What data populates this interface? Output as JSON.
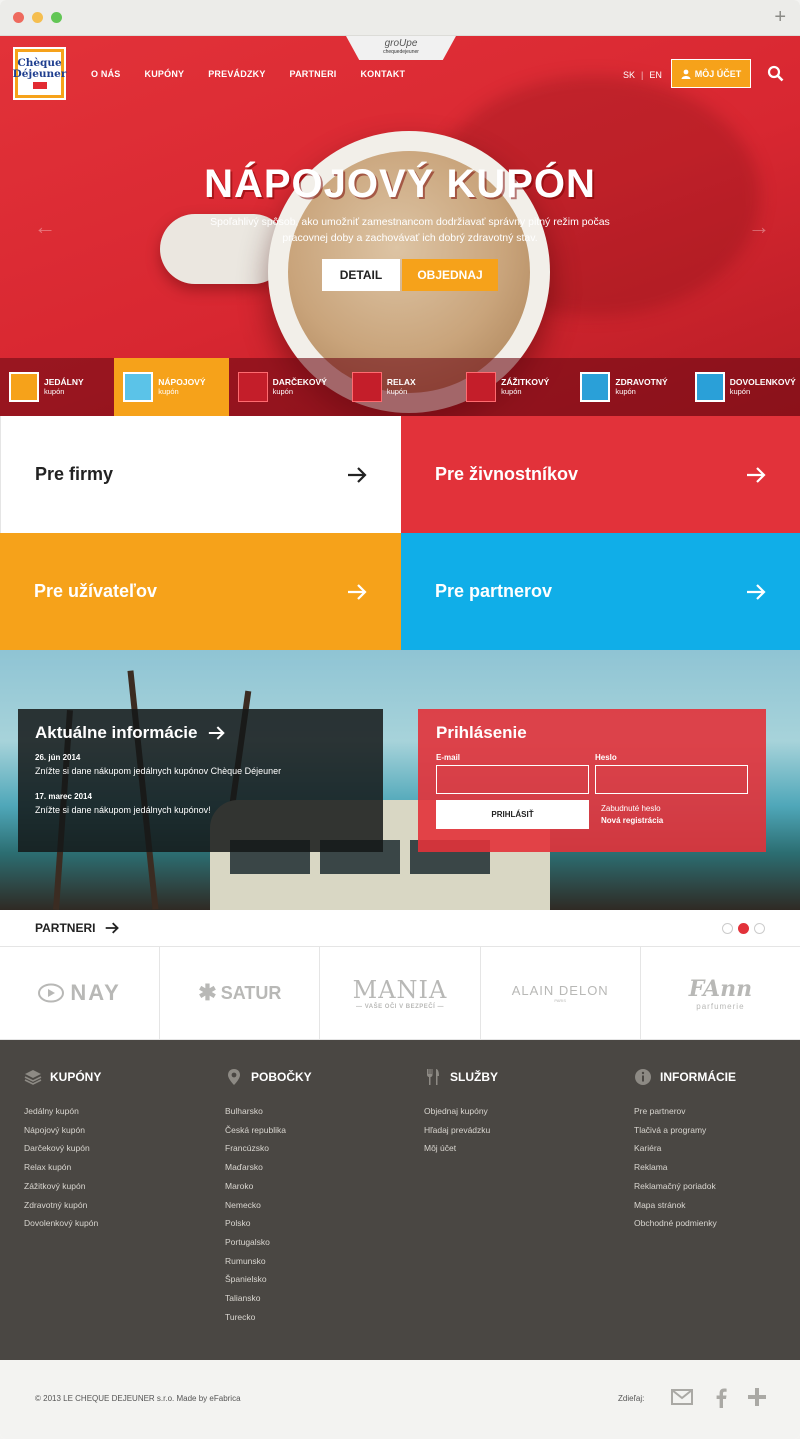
{
  "browser": {
    "new_tab": "+"
  },
  "header": {
    "logo_line1": "Chèque",
    "logo_line2": "Déjeuner",
    "groupe_name": "groUpe",
    "groupe_sub": "chequedejeuner",
    "nav": [
      "O NÁS",
      "KUPÓNY",
      "PREVÁDZKY",
      "PARTNERI",
      "KONTAKT"
    ],
    "lang_sk": "SK",
    "lang_sep": "|",
    "lang_en": "EN",
    "account_label": "MÔJ ÚČET"
  },
  "hero": {
    "title": "NÁPOJOVÝ KUPÓN",
    "desc": "Spoľahlivý spôsob, ako umožniť zamestnancom dodržiavať správny pitný režim počas pracovnej doby a zachovávať ich dobrý zdravotný stav.",
    "detail_label": "DETAIL",
    "order_label": "OBJEDNAJ",
    "prev_arrow": "←",
    "next_arrow": "→"
  },
  "kupony": [
    {
      "name": "JEDÁLNY",
      "sub": "kupón",
      "icon_text": "Chèque Déjeuner",
      "color": "#f6a21a"
    },
    {
      "name": "NÁPOJOVÝ",
      "sub": "kupón",
      "icon_text": "Chèque aqua",
      "color": "#5bc3e8"
    },
    {
      "name": "DARČEKOVÝ",
      "sub": "kupón",
      "icon_text": "Cadhoc",
      "color": "#c41e2a"
    },
    {
      "name": "RELAX",
      "sub": "kupón",
      "icon_text": "Cadhoc",
      "color": "#c41e2a"
    },
    {
      "name": "ZÁŽITKOVÝ",
      "sub": "kupón",
      "icon_text": "Cadhoc",
      "color": "#c41e2a"
    },
    {
      "name": "ZDRAVOTNÝ",
      "sub": "kupón",
      "icon_text": "Chèque médical",
      "color": "#2aa0d8"
    },
    {
      "name": "DOVOLENKOVÝ",
      "sub": "kupón",
      "icon_text": "Chèque vacances",
      "color": "#2aa0d8"
    }
  ],
  "tiles": [
    "Pre firmy",
    "Pre živnostníkov",
    "Pre užívateľov",
    "Pre partnerov"
  ],
  "news": {
    "title": "Aktuálne informácie",
    "items": [
      {
        "date": "26. jún 2014",
        "text": "Znížte si dane nákupom jedálnych kupónov Chèque Déjeuner"
      },
      {
        "date": "17. marec 2014",
        "text": "Znížte si dane nákupom jedálnych kupónov!"
      }
    ]
  },
  "login": {
    "title": "Prihlásenie",
    "email_label": "E-mail",
    "password_label": "Heslo",
    "submit_label": "PRIHLÁSIŤ",
    "forgot": "Zabudnuté heslo",
    "register": "Nová registrácia"
  },
  "partners": {
    "title": "PARTNERI",
    "logos": [
      "NAY",
      "SATUR",
      "MANIA",
      "ALAIN DELON",
      "FAnn"
    ],
    "mania_sub": "— VAŠE OČI V BEZPEČÍ —",
    "fann_sub": "parfumerie",
    "delon_sub": "PARIS"
  },
  "footer": {
    "columns": [
      {
        "title": "KUPÓNY",
        "icon": "layers-icon",
        "links": [
          "Jedálny kupón",
          "Nápojový kupón",
          "Darčekový kupón",
          "Relax kupón",
          "Zážitkový kupón",
          "Zdravotný kupón",
          "Dovolenkový kupón"
        ]
      },
      {
        "title": "POBOČKY",
        "icon": "map-pin-icon",
        "links": [
          "Bulharsko",
          "Česká republika",
          "Francúzsko",
          "Maďarsko",
          "Maroko",
          "Nemecko",
          "Polsko",
          "Portugalsko",
          "Rumunsko",
          "Španielsko",
          "Taliansko",
          "Turecko"
        ]
      },
      {
        "title": "SLUŽBY",
        "icon": "cutlery-icon",
        "links": [
          "Objednaj kupóny",
          "Hľadaj prevádzku",
          "Môj účet"
        ]
      },
      {
        "title": "INFORMÁCIE",
        "icon": "info-icon",
        "links": [
          "Pre partnerov",
          "Tlačivá a programy",
          "Kariéra",
          "Reklama",
          "Reklamačný poriadok",
          "Mapa stránok",
          "Obchodné podmienky"
        ]
      }
    ],
    "copyright": "© 2013 LE CHEQUE DEJEUNER s.r.o. Made by eFabrica",
    "share_label": "Zdieľaj:",
    "share_icons": [
      "mail-icon",
      "facebook-icon",
      "plus-icon"
    ]
  },
  "colors": {
    "red": "#e2323a",
    "orange": "#f6a21a",
    "blue": "#10aee8",
    "footer": "#4a4743"
  }
}
